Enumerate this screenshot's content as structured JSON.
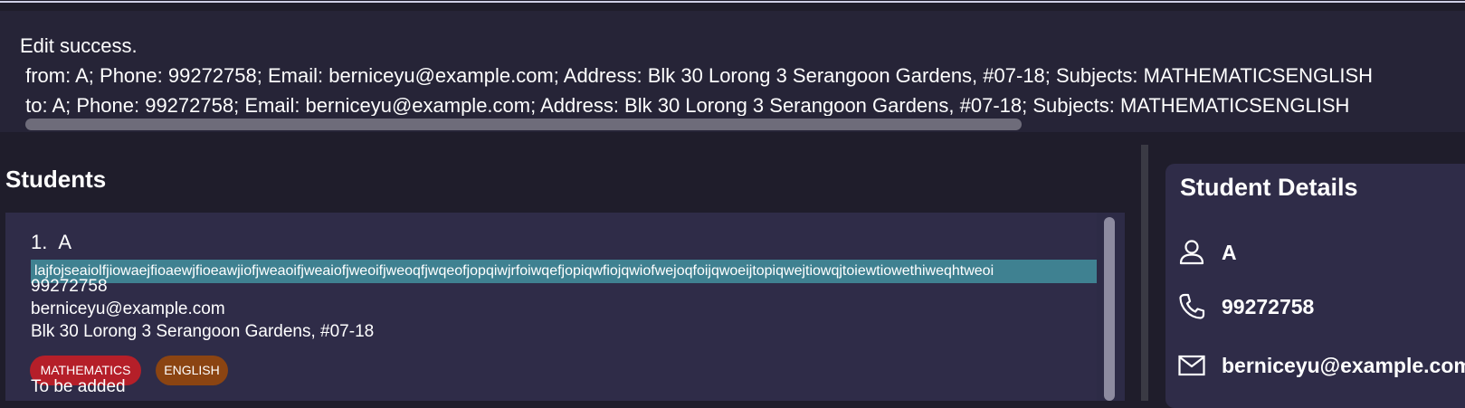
{
  "result": {
    "line1": "Edit success.",
    "line2": " from: A; Phone: 99272758; Email: berniceyu@example.com; Address: Blk 30 Lorong 3 Serangoon Gardens, #07-18; Subjects: MATHEMATICSENGLISH",
    "line3": " to: A; Phone: 99272758; Email: berniceyu@example.com; Address: Blk 30 Lorong 3 Serangoon Gardens, #07-18; Subjects: MATHEMATICSENGLISH"
  },
  "students_panel": {
    "title": "Students",
    "card": {
      "index": "1.",
      "name": "A",
      "highlight": "lajfojseaiolfjiowaejfioaewjfioeawjiofjweaoifjweaiofjweoifjweoqfjwqeofjopqiwjrfoiwqefjopiqwfiojqwiofwejoqfoijqwoeijtopiqwejtiowqjtoiewtiowethiweqhtweoi",
      "phone": "99272758",
      "email": "berniceyu@example.com",
      "address": "Blk 30 Lorong 3 Serangoon Gardens, #07-18",
      "tags": [
        {
          "label": "MATHEMATICS",
          "color": "#b51f29"
        },
        {
          "label": "ENGLISH",
          "color": "#8b4412"
        }
      ],
      "remark": "To be added"
    }
  },
  "details_panel": {
    "title": "Student Details",
    "name": "A",
    "phone": "99272758",
    "email": "berniceyu@example.com",
    "icons": [
      "person-icon",
      "phone-icon",
      "email-icon"
    ]
  }
}
